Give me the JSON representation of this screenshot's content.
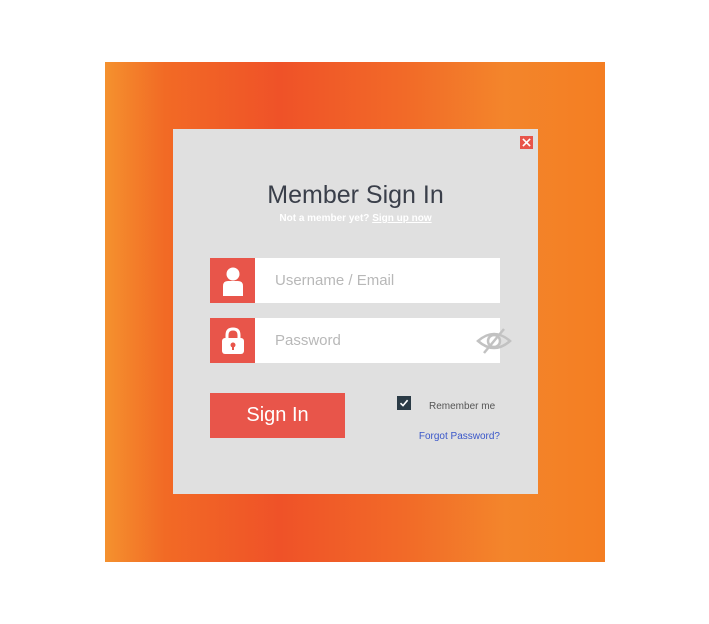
{
  "modal": {
    "title": "Member Sign In",
    "subtitle_text": "Not a member yet?",
    "signup_link": "Sign up now"
  },
  "form": {
    "username_placeholder": "Username / Email",
    "password_placeholder": "Password",
    "signin_label": "Sign In",
    "remember_label": "Remember me",
    "remember_checked": true,
    "forgot_label": "Forgot Password?"
  },
  "icons": {
    "close": "close-icon",
    "user": "user-icon",
    "lock": "lock-icon",
    "eye": "eye-slash-icon",
    "check": "checkmark-icon"
  },
  "colors": {
    "accent": "#e8554a",
    "modal_bg": "#e0e0e0",
    "gradient_orange": "#f26a25",
    "link": "#3a57c9"
  }
}
